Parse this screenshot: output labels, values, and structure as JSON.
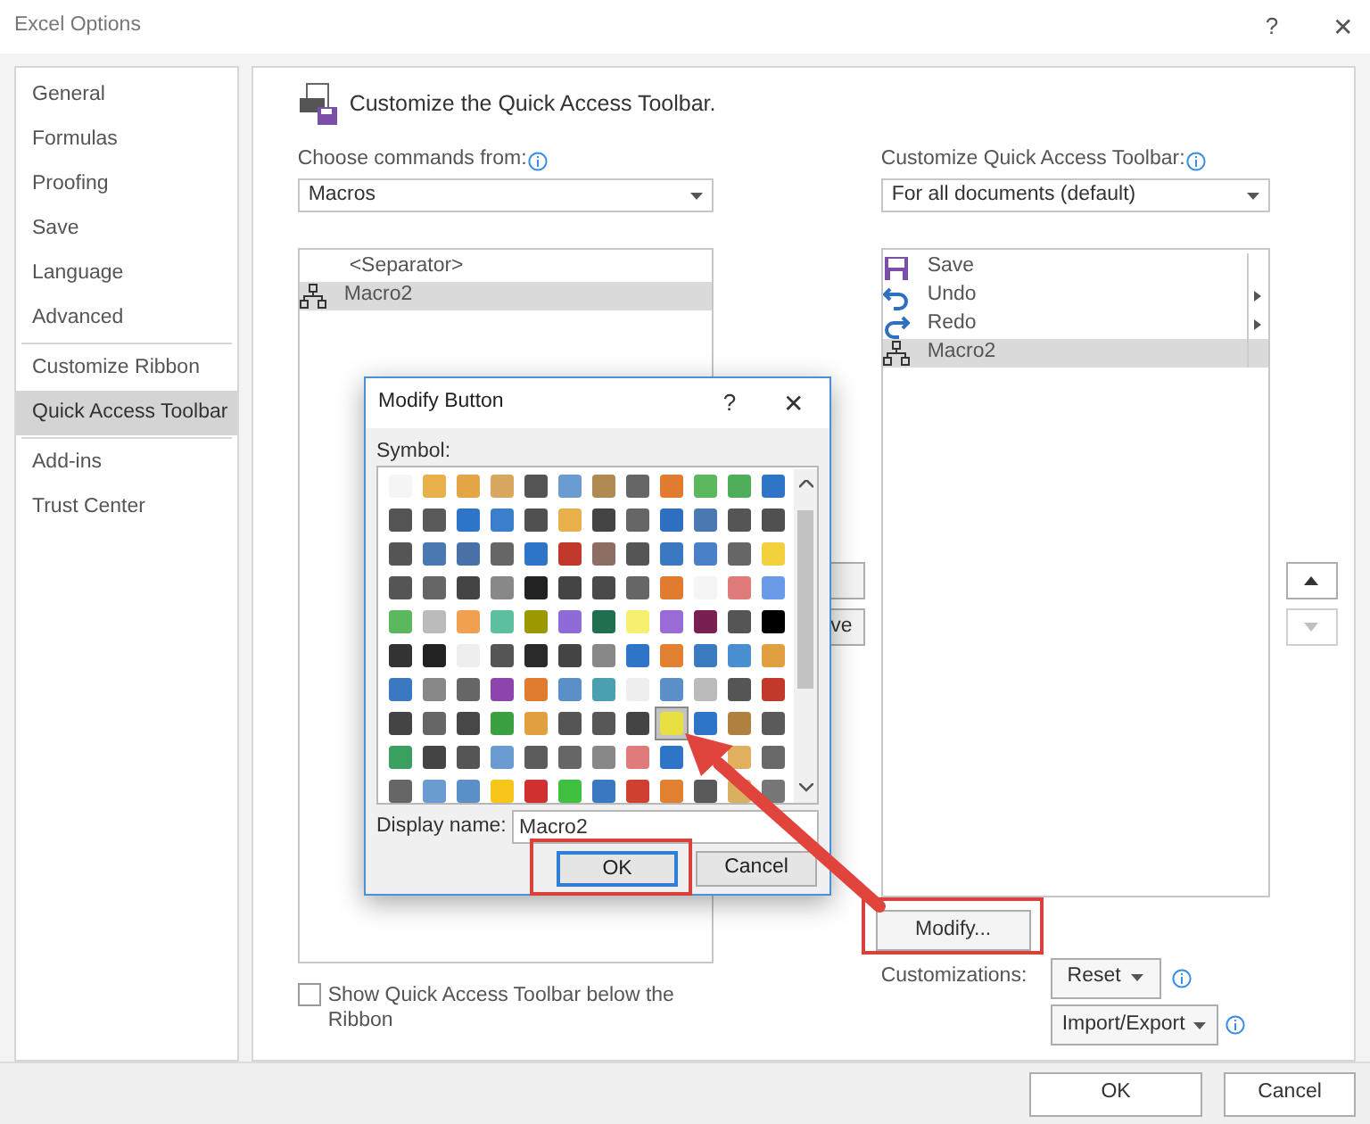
{
  "window": {
    "title": "Excel Options",
    "help": "?",
    "close": "✕"
  },
  "sidebar": {
    "groups": [
      [
        {
          "label": "General",
          "selected": false
        },
        {
          "label": "Formulas",
          "selected": false
        },
        {
          "label": "Proofing",
          "selected": false
        },
        {
          "label": "Save",
          "selected": false
        },
        {
          "label": "Language",
          "selected": false
        },
        {
          "label": "Advanced",
          "selected": false
        }
      ],
      [
        {
          "label": "Customize Ribbon",
          "selected": false
        },
        {
          "label": "Quick Access Toolbar",
          "selected": true
        }
      ],
      [
        {
          "label": "Add-ins",
          "selected": false
        },
        {
          "label": "Trust Center",
          "selected": false
        }
      ]
    ]
  },
  "heading": "Customize the Quick Access Toolbar.",
  "commands": {
    "label": "Choose commands from:",
    "value": "Macros",
    "items": [
      {
        "kind": "separator",
        "label": "<Separator>",
        "selected": false
      },
      {
        "kind": "macro",
        "label": "Macro2",
        "selected": true
      }
    ]
  },
  "remove_button": "ve",
  "toolbar": {
    "label": "Customize Quick Access Toolbar:",
    "value": "For all documents (default)",
    "items": [
      {
        "kind": "save",
        "label": "Save",
        "submenu": false,
        "selected": false
      },
      {
        "kind": "undo",
        "label": "Undo",
        "submenu": true,
        "selected": false
      },
      {
        "kind": "redo",
        "label": "Redo",
        "submenu": true,
        "selected": false
      },
      {
        "kind": "macro",
        "label": "Macro2",
        "submenu": false,
        "selected": true
      }
    ]
  },
  "move_buttons": [
    {
      "kind": "up",
      "disabled": false
    },
    {
      "kind": "down",
      "disabled": true
    }
  ],
  "modify_button": "Modify...",
  "customizations": {
    "label": "Customizations:",
    "reset": "Reset",
    "import_export": "Import/Export"
  },
  "show_below": {
    "label": "Show Quick Access Toolbar below the Ribbon",
    "checked": false
  },
  "footer": {
    "ok": "OK",
    "cancel": "Cancel"
  },
  "modify_dialog": {
    "title": "Modify Button",
    "help": "?",
    "close": "✕",
    "symbol_label": "Symbol:",
    "display_name_label": "Display name:",
    "display_name": "Macro2",
    "ok": "OK",
    "cancel": "Cancel",
    "symbols": [
      [
        {
          "color": "#f5f5f5",
          "selected": false
        },
        {
          "color": "#e8b04a",
          "selected": false
        },
        {
          "color": "#e3a545",
          "selected": false
        },
        {
          "color": "#d8a860",
          "selected": false
        },
        {
          "color": "#555555",
          "selected": false
        },
        {
          "color": "#6a9bd1",
          "selected": false
        },
        {
          "color": "#b08a50",
          "selected": false
        },
        {
          "color": "#666666",
          "selected": false
        },
        {
          "color": "#e07b30",
          "selected": false
        },
        {
          "color": "#5cb85c",
          "selected": false
        },
        {
          "color": "#4fae5a",
          "selected": false
        },
        {
          "color": "#2e75c7",
          "selected": false
        }
      ],
      [
        {
          "color": "#555555",
          "selected": false
        },
        {
          "color": "#5a5a5a",
          "selected": false
        },
        {
          "color": "#2e75c7",
          "selected": false
        },
        {
          "color": "#3a7fcc",
          "selected": false
        },
        {
          "color": "#505050",
          "selected": false
        },
        {
          "color": "#e8b04a",
          "selected": false
        },
        {
          "color": "#444444",
          "selected": false
        },
        {
          "color": "#666666",
          "selected": false
        },
        {
          "color": "#2e6fc0",
          "selected": false
        },
        {
          "color": "#4a78b0",
          "selected": false
        },
        {
          "color": "#555555",
          "selected": false
        },
        {
          "color": "#505050",
          "selected": false
        }
      ],
      [
        {
          "color": "#555555",
          "selected": false
        },
        {
          "color": "#4a78b0",
          "selected": false
        },
        {
          "color": "#4a70a8",
          "selected": false
        },
        {
          "color": "#666666",
          "selected": false
        },
        {
          "color": "#2e75c7",
          "selected": false
        },
        {
          "color": "#c0392b",
          "selected": false
        },
        {
          "color": "#8d6e63",
          "selected": false
        },
        {
          "color": "#555555",
          "selected": false
        },
        {
          "color": "#3a78c2",
          "selected": false
        },
        {
          "color": "#4a80c8",
          "selected": false
        },
        {
          "color": "#666666",
          "selected": false
        },
        {
          "color": "#f4d03f",
          "selected": false
        }
      ],
      [
        {
          "color": "#555555",
          "selected": false
        },
        {
          "color": "#666666",
          "selected": false
        },
        {
          "color": "#444444",
          "selected": false
        },
        {
          "color": "#888888",
          "selected": false
        },
        {
          "color": "#222222",
          "selected": false
        },
        {
          "color": "#444444",
          "selected": false
        },
        {
          "color": "#4a4a4a",
          "selected": false
        },
        {
          "color": "#666666",
          "selected": false
        },
        {
          "color": "#e07b30",
          "selected": false
        },
        {
          "color": "#f5f5f5",
          "selected": false
        },
        {
          "color": "#e07b7b",
          "selected": false
        },
        {
          "color": "#6a9be8",
          "selected": false
        }
      ],
      [
        {
          "color": "#5cb85c",
          "selected": false
        },
        {
          "color": "#bbbbbb",
          "selected": false
        },
        {
          "color": "#f0a050",
          "selected": false
        },
        {
          "color": "#5cc0a0",
          "selected": false
        },
        {
          "color": "#9a9a00",
          "selected": false
        },
        {
          "color": "#8e6bd6",
          "selected": false
        },
        {
          "color": "#207050",
          "selected": false
        },
        {
          "color": "#f5f070",
          "selected": false
        },
        {
          "color": "#9a6bd6",
          "selected": false
        },
        {
          "color": "#7a2050",
          "selected": false
        },
        {
          "color": "#555555",
          "selected": false
        },
        {
          "color": "#000000",
          "selected": false
        }
      ],
      [
        {
          "color": "#333333",
          "selected": false
        },
        {
          "color": "#222222",
          "selected": false
        },
        {
          "color": "#eeeeee",
          "selected": false
        },
        {
          "color": "#555555",
          "selected": false
        },
        {
          "color": "#2a2a2a",
          "selected": false
        },
        {
          "color": "#444444",
          "selected": false
        },
        {
          "color": "#888888",
          "selected": false
        },
        {
          "color": "#2e75c7",
          "selected": false
        },
        {
          "color": "#e08030",
          "selected": false
        },
        {
          "color": "#3a7abf",
          "selected": false
        },
        {
          "color": "#4a90d0",
          "selected": false
        },
        {
          "color": "#e0a040",
          "selected": false
        }
      ],
      [
        {
          "color": "#3a78c2",
          "selected": false
        },
        {
          "color": "#888888",
          "selected": false
        },
        {
          "color": "#666666",
          "selected": false
        },
        {
          "color": "#8e44ad",
          "selected": false
        },
        {
          "color": "#e07b30",
          "selected": false
        },
        {
          "color": "#5b8fc7",
          "selected": false
        },
        {
          "color": "#4aa0b0",
          "selected": false
        },
        {
          "color": "#eeeeee",
          "selected": false
        },
        {
          "color": "#5b8fc7",
          "selected": false
        },
        {
          "color": "#bbbbbb",
          "selected": false
        },
        {
          "color": "#555555",
          "selected": false
        },
        {
          "color": "#c0392b",
          "selected": false
        }
      ],
      [
        {
          "color": "#444444",
          "selected": false
        },
        {
          "color": "#666666",
          "selected": false
        },
        {
          "color": "#474747",
          "selected": false
        },
        {
          "color": "#3aa040",
          "selected": false
        },
        {
          "color": "#e0a040",
          "selected": false
        },
        {
          "color": "#555555",
          "selected": false
        },
        {
          "color": "#575757",
          "selected": false
        },
        {
          "color": "#444444",
          "selected": false
        },
        {
          "color": "#e8e040",
          "selected": true
        },
        {
          "color": "#2e75c7",
          "selected": false
        },
        {
          "color": "#b08040",
          "selected": false
        },
        {
          "color": "#5a5a5a",
          "selected": false
        }
      ],
      [
        {
          "color": "#3aa060",
          "selected": false
        },
        {
          "color": "#444444",
          "selected": false
        },
        {
          "color": "#555555",
          "selected": false
        },
        {
          "color": "#6a9bd1",
          "selected": false
        },
        {
          "color": "#5c5c5c",
          "selected": false
        },
        {
          "color": "#666666",
          "selected": false
        },
        {
          "color": "#888888",
          "selected": false
        },
        {
          "color": "#e07b7b",
          "selected": false
        },
        {
          "color": "#2e75c7",
          "selected": false
        },
        {
          "kind": "covered"
        },
        {
          "color": "#e0b060",
          "selected": false
        },
        {
          "color": "#686868",
          "selected": false
        }
      ],
      [
        {
          "color": "#666666",
          "selected": false
        },
        {
          "color": "#6a9bd1",
          "selected": false
        },
        {
          "color": "#5b8fc7",
          "selected": false
        },
        {
          "color": "#f5c518",
          "selected": false
        },
        {
          "color": "#d03030",
          "selected": false
        },
        {
          "color": "#40c040",
          "selected": false
        },
        {
          "color": "#3a78c2",
          "selected": false
        },
        {
          "color": "#d04030",
          "selected": false
        },
        {
          "color": "#e08030",
          "selected": false
        },
        {
          "color": "#595959",
          "selected": false
        },
        {
          "color": "#d8b060",
          "selected": false
        },
        {
          "color": "#777777",
          "selected": false
        }
      ]
    ]
  }
}
